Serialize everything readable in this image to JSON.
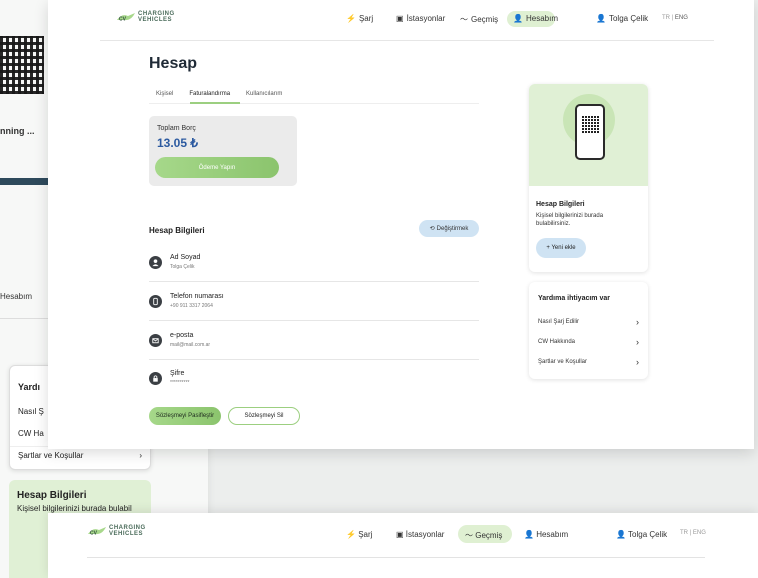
{
  "brand": {
    "line1": "CHARGING",
    "line2": "VEHICLES",
    "mono": "CV"
  },
  "nav": {
    "sarj": "Şarj",
    "istasyonlar": "İstasyonlar",
    "gecmis": "Geçmiş",
    "hesabim": "Hesabım",
    "user": "Tolga Çelik",
    "lang_tr": "TR",
    "lang_sep": " | ",
    "lang_en": "ENG"
  },
  "page": {
    "title": "Hesap"
  },
  "tabs": [
    {
      "label": "Kişisel",
      "active": false
    },
    {
      "label": "Faturalandırma",
      "active": true
    },
    {
      "label": "Kullanıcılarım",
      "active": false
    }
  ],
  "debt": {
    "label": "Toplam Borç",
    "value": "13.05 ₺",
    "pay_label": "Ödeme Yapın"
  },
  "account": {
    "title": "Hesap Bilgileri",
    "change_label": "Değiştirmek",
    "rows": [
      {
        "label": "Ad Soyad",
        "value": "Tolga Çelik"
      },
      {
        "label": "Telefon numarası",
        "value": "+90 911 3317 2064"
      },
      {
        "label": "e-posta",
        "value": "mail@mail.com.ar"
      },
      {
        "label": "Şifre",
        "value": "**********"
      }
    ],
    "deactivate_label": "Sözleşmeyi Pasifleştir",
    "delete_label": "Sözleşmeyi Sil"
  },
  "side_info": {
    "title": "Hesap Bilgileri",
    "subtitle": "Kişisel bilgilerinizi burada bulabilirsiniz.",
    "new_label": "+ Yeni ekle"
  },
  "help": {
    "title": "Yardıma ihtiyacım var",
    "items": [
      "Nasıl Şarj Edilir",
      "CW Hakkında",
      "Şartlar ve Koşullar"
    ]
  },
  "bg_left": {
    "scanning": "nning ...",
    "hesabim": "Hesabım",
    "help_title": "Yardı",
    "help_item1": "Nasıl Ş",
    "help_item2": "CW Ha",
    "help_item3": "Şartlar ve Koşullar",
    "info_title": "Hesap Bilgileri",
    "info_sub": "Kişisel bilgilerinizi burada bulabil"
  },
  "bg_bottom": {
    "sarj": "Şarj",
    "istasyonlar": "İstasyonlar",
    "gecmis": "Geçmiş",
    "hesabim": "Hesabım",
    "user": "Tolga Çelik",
    "lang": "TR | ENG"
  },
  "colors": {
    "accent_green": "#9ccf80",
    "accent_blue": "#cfe3f3",
    "debt_blue": "#2c5aa0"
  }
}
